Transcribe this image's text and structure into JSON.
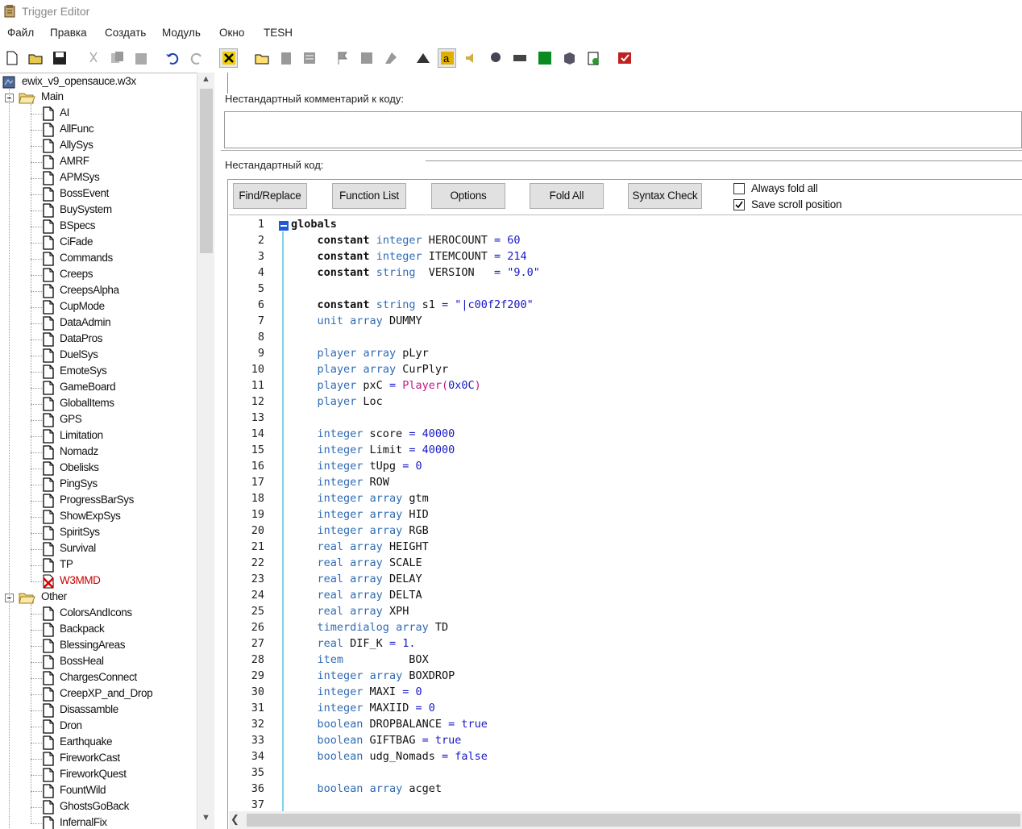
{
  "window": {
    "title": "Trigger Editor"
  },
  "menu": [
    "Файл",
    "Правка",
    "Создать",
    "Модуль",
    "Окно",
    "TESH"
  ],
  "tree": {
    "root": "ewix_v9_opensauce.w3x",
    "folders": [
      {
        "name": "Main",
        "items": [
          "AI",
          "AllFunc",
          "AllySys",
          "AMRF",
          "APMSys",
          "BossEvent",
          "BuySystem",
          "BSpecs",
          "CiFade",
          "Commands",
          "Creeps",
          "CreepsAlpha",
          "CupMode",
          "DataAdmin",
          "DataPros",
          "DuelSys",
          "EmoteSys",
          "GameBoard",
          "GlobalItems",
          "GPS",
          "Limitation",
          "Nomadz",
          "Obelisks",
          "PingSys",
          "ProgressBarSys",
          "ShowExpSys",
          "SpiritSys",
          "Survival",
          "TP",
          "W3MMD"
        ],
        "disabled_item": "W3MMD"
      },
      {
        "name": "Other",
        "items": [
          "ColorsAndIcons",
          "Backpack",
          "BlessingAreas",
          "BossHeal",
          "ChargesConnect",
          "CreepXP_and_Drop",
          "Disassamble",
          "Dron",
          "Earthquake",
          "FireworkCast",
          "FireworkQuest",
          "FountWild",
          "GhostsGoBack",
          "InfernalFix"
        ]
      }
    ]
  },
  "panel": {
    "comment_label": "Нестандартный комментарий к коду:",
    "code_label": "Нестандартный код:"
  },
  "buttons": [
    "Find/Replace",
    "Function List",
    "Options",
    "Fold All",
    "Syntax Check"
  ],
  "checkboxes": [
    {
      "label": "Always fold all",
      "checked": false
    },
    {
      "label": "Save scroll position",
      "checked": true
    }
  ],
  "code": [
    {
      "n": "1",
      "t": [
        [
          "kw",
          "globals"
        ]
      ]
    },
    {
      "n": "2",
      "t": [
        [
          "",
          "    "
        ],
        [
          "kw",
          "constant"
        ],
        [
          "",
          " "
        ],
        [
          "ty",
          "integer"
        ],
        [
          "",
          " HEROCOUNT "
        ],
        [
          "op",
          "="
        ],
        [
          "",
          " "
        ],
        [
          "num",
          "60"
        ]
      ]
    },
    {
      "n": "3",
      "t": [
        [
          "",
          "    "
        ],
        [
          "kw",
          "constant"
        ],
        [
          "",
          " "
        ],
        [
          "ty",
          "integer"
        ],
        [
          "",
          " ITEMCOUNT "
        ],
        [
          "op",
          "="
        ],
        [
          "",
          " "
        ],
        [
          "num",
          "214"
        ]
      ]
    },
    {
      "n": "4",
      "t": [
        [
          "",
          "    "
        ],
        [
          "kw",
          "constant"
        ],
        [
          "",
          " "
        ],
        [
          "ty",
          "string"
        ],
        [
          "",
          "  VERSION   "
        ],
        [
          "op",
          "="
        ],
        [
          "",
          " "
        ],
        [
          "str",
          "\"9.0\""
        ]
      ]
    },
    {
      "n": "5",
      "t": []
    },
    {
      "n": "6",
      "t": [
        [
          "",
          "    "
        ],
        [
          "kw",
          "constant"
        ],
        [
          "",
          " "
        ],
        [
          "ty",
          "string"
        ],
        [
          "",
          " s1 "
        ],
        [
          "op",
          "="
        ],
        [
          "",
          " "
        ],
        [
          "str",
          "\"|c00f2f200\""
        ]
      ]
    },
    {
      "n": "7",
      "t": [
        [
          "",
          "    "
        ],
        [
          "ty",
          "unit"
        ],
        [
          "",
          " "
        ],
        [
          "ty",
          "array"
        ],
        [
          "",
          " DUMMY"
        ]
      ]
    },
    {
      "n": "8",
      "t": []
    },
    {
      "n": "9",
      "t": [
        [
          "",
          "    "
        ],
        [
          "ty",
          "player"
        ],
        [
          "",
          " "
        ],
        [
          "ty",
          "array"
        ],
        [
          "",
          " pLyr"
        ]
      ]
    },
    {
      "n": "10",
      "t": [
        [
          "",
          "    "
        ],
        [
          "ty",
          "player"
        ],
        [
          "",
          " "
        ],
        [
          "ty",
          "array"
        ],
        [
          "",
          " CurPlyr"
        ]
      ]
    },
    {
      "n": "11",
      "t": [
        [
          "",
          "    "
        ],
        [
          "ty",
          "player"
        ],
        [
          "",
          " pxC "
        ],
        [
          "op",
          "="
        ],
        [
          "",
          " "
        ],
        [
          "fn",
          "Player("
        ],
        [
          "num",
          "0x0C"
        ],
        [
          "fn",
          ")"
        ]
      ]
    },
    {
      "n": "12",
      "t": [
        [
          "",
          "    "
        ],
        [
          "ty",
          "player"
        ],
        [
          "",
          " Loc"
        ]
      ]
    },
    {
      "n": "13",
      "t": []
    },
    {
      "n": "14",
      "t": [
        [
          "",
          "    "
        ],
        [
          "ty",
          "integer"
        ],
        [
          "",
          " score "
        ],
        [
          "op",
          "="
        ],
        [
          "",
          " "
        ],
        [
          "num",
          "40000"
        ]
      ]
    },
    {
      "n": "15",
      "t": [
        [
          "",
          "    "
        ],
        [
          "ty",
          "integer"
        ],
        [
          "",
          " Limit "
        ],
        [
          "op",
          "="
        ],
        [
          "",
          " "
        ],
        [
          "num",
          "40000"
        ]
      ]
    },
    {
      "n": "16",
      "t": [
        [
          "",
          "    "
        ],
        [
          "ty",
          "integer"
        ],
        [
          "",
          " tUpg "
        ],
        [
          "op",
          "="
        ],
        [
          "",
          " "
        ],
        [
          "num",
          "0"
        ]
      ]
    },
    {
      "n": "17",
      "t": [
        [
          "",
          "    "
        ],
        [
          "ty",
          "integer"
        ],
        [
          "",
          " ROW"
        ]
      ]
    },
    {
      "n": "18",
      "t": [
        [
          "",
          "    "
        ],
        [
          "ty",
          "integer"
        ],
        [
          "",
          " "
        ],
        [
          "ty",
          "array"
        ],
        [
          "",
          " gtm"
        ]
      ]
    },
    {
      "n": "19",
      "t": [
        [
          "",
          "    "
        ],
        [
          "ty",
          "integer"
        ],
        [
          "",
          " "
        ],
        [
          "ty",
          "array"
        ],
        [
          "",
          " HID"
        ]
      ]
    },
    {
      "n": "20",
      "t": [
        [
          "",
          "    "
        ],
        [
          "ty",
          "integer"
        ],
        [
          "",
          " "
        ],
        [
          "ty",
          "array"
        ],
        [
          "",
          " RGB"
        ]
      ]
    },
    {
      "n": "21",
      "t": [
        [
          "",
          "    "
        ],
        [
          "ty",
          "real"
        ],
        [
          "",
          " "
        ],
        [
          "ty",
          "array"
        ],
        [
          "",
          " HEIGHT"
        ]
      ]
    },
    {
      "n": "22",
      "t": [
        [
          "",
          "    "
        ],
        [
          "ty",
          "real"
        ],
        [
          "",
          " "
        ],
        [
          "ty",
          "array"
        ],
        [
          "",
          " SCALE"
        ]
      ]
    },
    {
      "n": "23",
      "t": [
        [
          "",
          "    "
        ],
        [
          "ty",
          "real"
        ],
        [
          "",
          " "
        ],
        [
          "ty",
          "array"
        ],
        [
          "",
          " DELAY"
        ]
      ]
    },
    {
      "n": "24",
      "t": [
        [
          "",
          "    "
        ],
        [
          "ty",
          "real"
        ],
        [
          "",
          " "
        ],
        [
          "ty",
          "array"
        ],
        [
          "",
          " DELTA"
        ]
      ]
    },
    {
      "n": "25",
      "t": [
        [
          "",
          "    "
        ],
        [
          "ty",
          "real"
        ],
        [
          "",
          " "
        ],
        [
          "ty",
          "array"
        ],
        [
          "",
          " XPH"
        ]
      ]
    },
    {
      "n": "26",
      "t": [
        [
          "",
          "    "
        ],
        [
          "ty",
          "timerdialog"
        ],
        [
          "",
          " "
        ],
        [
          "ty",
          "array"
        ],
        [
          "",
          " TD"
        ]
      ]
    },
    {
      "n": "27",
      "t": [
        [
          "",
          "    "
        ],
        [
          "ty",
          "real"
        ],
        [
          "",
          " DIF_K "
        ],
        [
          "op",
          "="
        ],
        [
          "",
          " "
        ],
        [
          "num",
          "1."
        ]
      ]
    },
    {
      "n": "28",
      "t": [
        [
          "",
          "    "
        ],
        [
          "ty",
          "item"
        ],
        [
          "",
          "          BOX"
        ]
      ]
    },
    {
      "n": "29",
      "t": [
        [
          "",
          "    "
        ],
        [
          "ty",
          "integer"
        ],
        [
          "",
          " "
        ],
        [
          "ty",
          "array"
        ],
        [
          "",
          " BOXDROP"
        ]
      ]
    },
    {
      "n": "30",
      "t": [
        [
          "",
          "    "
        ],
        [
          "ty",
          "integer"
        ],
        [
          "",
          " MAXI "
        ],
        [
          "op",
          "="
        ],
        [
          "",
          " "
        ],
        [
          "num",
          "0"
        ]
      ]
    },
    {
      "n": "31",
      "t": [
        [
          "",
          "    "
        ],
        [
          "ty",
          "integer"
        ],
        [
          "",
          " MAXIID "
        ],
        [
          "op",
          "="
        ],
        [
          "",
          " "
        ],
        [
          "num",
          "0"
        ]
      ]
    },
    {
      "n": "32",
      "t": [
        [
          "",
          "    "
        ],
        [
          "ty",
          "boolean"
        ],
        [
          "",
          " DROPBALANCE "
        ],
        [
          "op",
          "="
        ],
        [
          "",
          " "
        ],
        [
          "bool",
          "true"
        ]
      ]
    },
    {
      "n": "33",
      "t": [
        [
          "",
          "    "
        ],
        [
          "ty",
          "boolean"
        ],
        [
          "",
          " GIFTBAG "
        ],
        [
          "op",
          "="
        ],
        [
          "",
          " "
        ],
        [
          "bool",
          "true"
        ]
      ]
    },
    {
      "n": "34",
      "t": [
        [
          "",
          "    "
        ],
        [
          "ty",
          "boolean"
        ],
        [
          "",
          " udg_Nomads "
        ],
        [
          "op",
          "="
        ],
        [
          "",
          " "
        ],
        [
          "bool",
          "false"
        ]
      ]
    },
    {
      "n": "35",
      "t": []
    },
    {
      "n": "36",
      "t": [
        [
          "",
          "    "
        ],
        [
          "ty",
          "boolean"
        ],
        [
          "",
          " "
        ],
        [
          "ty",
          "array"
        ],
        [
          "",
          " acget"
        ]
      ]
    },
    {
      "n": "37",
      "t": []
    }
  ],
  "colors": {
    "keyword_type": "#2f6bb4",
    "literal": "#1818c8",
    "function": "#c0188a",
    "disabled_item": "#cc0000",
    "fold_bar": "#7fd3e6"
  }
}
